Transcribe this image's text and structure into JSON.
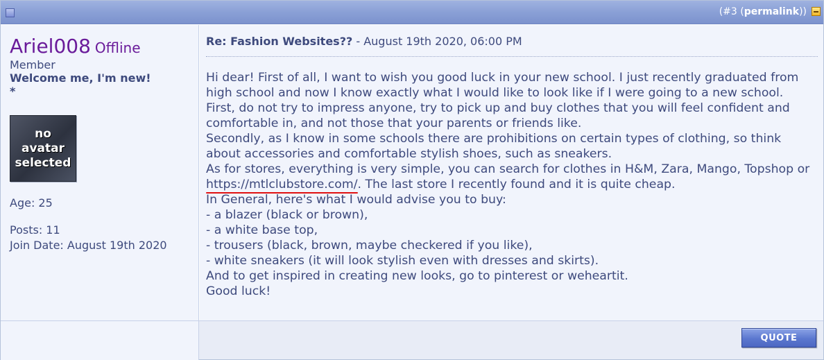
{
  "header": {
    "post_number": "(#3",
    "permalink_label": "permalink",
    "close_paren": "))"
  },
  "user": {
    "name": "Ariel008",
    "status": "Offline",
    "title": "Member",
    "rank": "Welcome me, I'm new!",
    "star": "*",
    "avatar_text_1": "no",
    "avatar_text_2": "avatar",
    "avatar_text_3": "selected",
    "age": "Age: 25",
    "posts": "Posts: 11",
    "join_date": "Join Date: August 19th 2020"
  },
  "message": {
    "title": "Re: Fashion Websites??",
    "separator": " - ",
    "date": "August 19th 2020, 06:00 PM",
    "lines": [
      "Hi dear! First of all, I want to wish you good luck in your new school. I just recently graduated from high school and now I know exactly what I would like to look like if I were going to a new school.",
      "First, do not try to impress anyone, try to pick up and buy clothes that you will feel confident and comfortable in, and not those that your parents or friends like.",
      "Secondly, as I know in some schools there are prohibitions on certain types of clothing, so think about accessories and comfortable stylish shoes, such as sneakers."
    ],
    "stores_before": "As for stores, everything is very simple, you can search for clothes in H&M, Zara, Mango, Topshop or ",
    "stores_link": "https://mtlclubstore.com/",
    "stores_after": ". The last store I recently found and it is quite cheap.",
    "lines_after": [
      "In General, here's what I would advise you to buy:",
      "- a blazer (black or brown),",
      "- a white base top,",
      "- trousers (black, brown, maybe checkered if you like),",
      "- white sneakers (it will look stylish even with dresses and skirts).",
      "And to get inspired in creating new looks, go to pinterest or weheartit.",
      "Good luck!"
    ]
  },
  "footer": {
    "quote_label": "QUOTE"
  },
  "colors": {
    "username": "#6a1b9a",
    "text": "#3e4a7d",
    "header_bar": "#8aa0d6",
    "link_underline": "#e01010"
  }
}
